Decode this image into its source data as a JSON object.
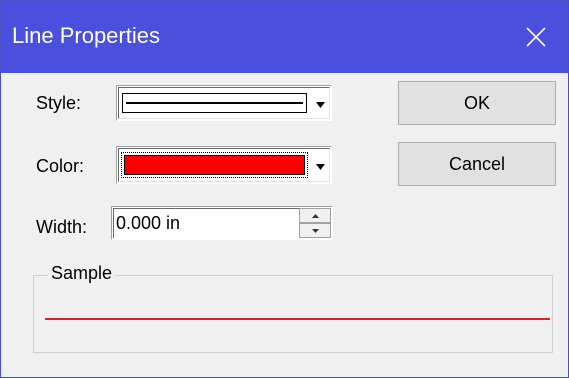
{
  "dialog": {
    "title": "Line Properties",
    "close_icon": "close-icon"
  },
  "style": {
    "label": "Style:",
    "selected": "solid-line"
  },
  "color": {
    "label": "Color:",
    "selected_color": "#ff0000"
  },
  "width": {
    "label": "Width:",
    "value": "0.000 in"
  },
  "buttons": {
    "ok": "OK",
    "cancel": "Cancel"
  },
  "sample": {
    "legend": "Sample",
    "line_color": "#e02020"
  }
}
